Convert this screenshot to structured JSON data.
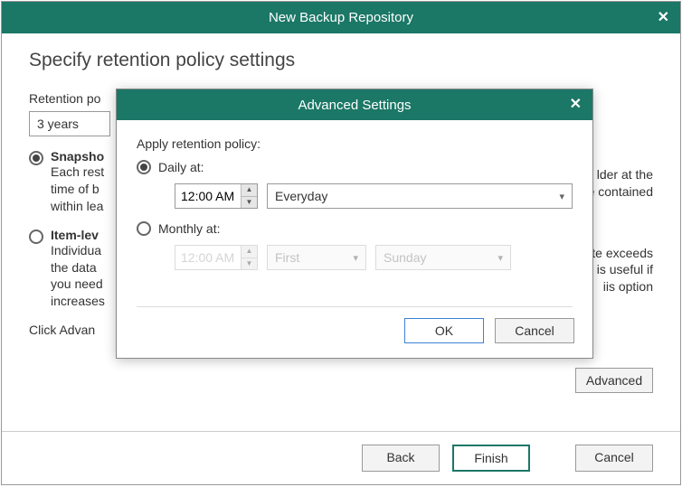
{
  "window": {
    "title": "New Backup Repository"
  },
  "page": {
    "heading": "Specify retention policy settings",
    "retention_label": "Retention po",
    "retention_value": "3 years",
    "opt_snapshot_title": "Snapsho",
    "opt_snapshot_desc_l1": "Each rest",
    "opt_snapshot_desc_l2": "time of b",
    "opt_snapshot_desc_l3": "within lea",
    "opt_snapshot_rdesc_l1": "lder at the",
    "opt_snapshot_rdesc_l2": "e contained",
    "opt_item_title": "Item-lev",
    "opt_item_desc_l1": "Individua",
    "opt_item_desc_l2": "the data",
    "opt_item_desc_l3": "you need",
    "opt_item_desc_l4": "increases",
    "opt_item_rdesc_l1": "date exceeds",
    "opt_item_rdesc_l2": "is useful if",
    "opt_item_rdesc_l3": "iis option",
    "adv_note": "Click Advan",
    "advanced_btn": "Advanced",
    "back_btn": "Back",
    "finish_btn": "Finish",
    "cancel_btn": "Cancel"
  },
  "modal": {
    "title": "Advanced Settings",
    "apply_label": "Apply retention policy:",
    "daily_label": "Daily at:",
    "daily_time": "12:00 AM",
    "daily_day": "Everyday",
    "monthly_label": "Monthly at:",
    "monthly_time": "12:00 AM",
    "monthly_ord": "First",
    "monthly_day": "Sunday",
    "ok_btn": "OK",
    "cancel_btn": "Cancel"
  }
}
